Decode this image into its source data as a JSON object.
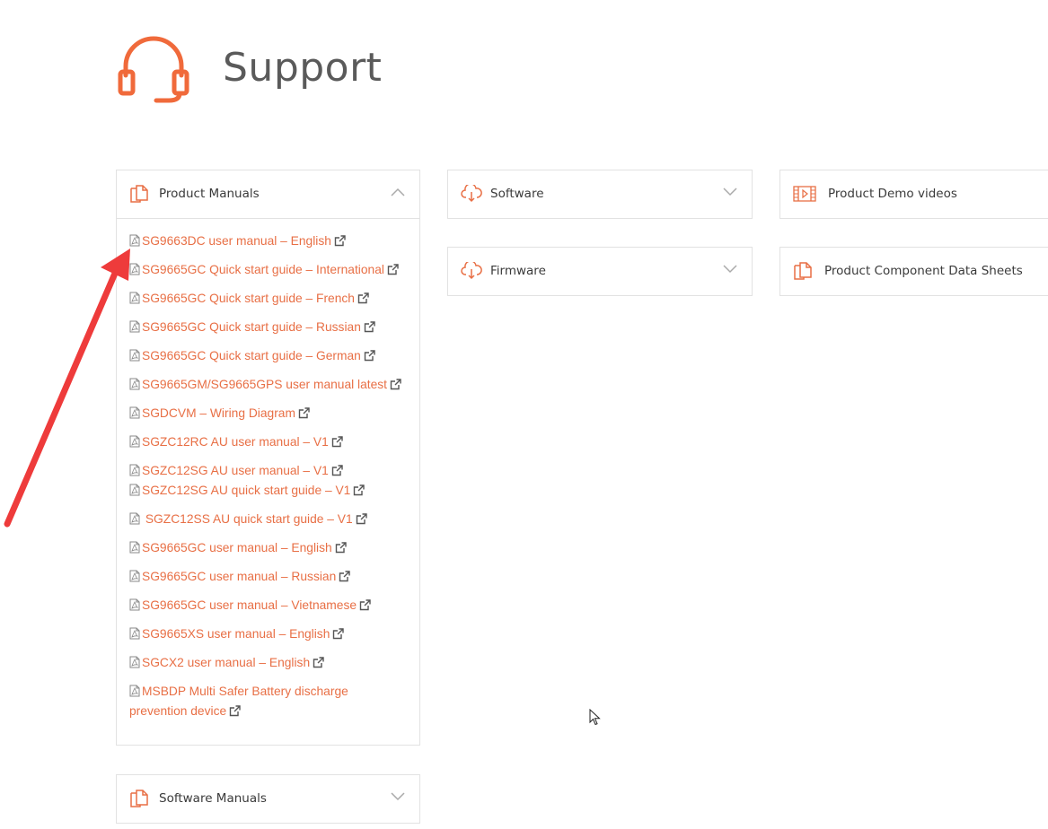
{
  "page": {
    "title": "Support"
  },
  "panels": {
    "product_manuals": {
      "label": "Product Manuals",
      "expanded": true
    },
    "software": {
      "label": "Software"
    },
    "product_demo_videos": {
      "label": "Product Demo videos"
    },
    "firmware": {
      "label": "Firmware"
    },
    "product_component_data_sheets": {
      "label": "Product Component Data Sheets"
    },
    "software_manuals": {
      "label": "Software Manuals"
    }
  },
  "manuals": [
    "SG9663DC user manual – English",
    "SG9665GC Quick start guide – International",
    "SG9665GC Quick start guide – French",
    "SG9665GC Quick start guide – Russian",
    "SG9665GC Quick start guide – German",
    "SG9665GM/SG9665GPS user manual latest",
    "SGDCVM – Wiring Diagram",
    "SGZC12RC AU user manual – V1",
    "SGZC12SG AU user manual – V1",
    "SGZC12SG AU quick start guide – V1",
    " SGZC12SS AU quick start guide – V1",
    "SG9665GC user manual – English",
    "SG9665GC user manual – Russian",
    "SG9665GC user manual – Vietnamese",
    "SG9665XS user manual – English",
    "SGCX2 user manual – English",
    "MSBDP Multi Safer Battery discharge prevention device"
  ],
  "colors": {
    "accent": "#e86f45",
    "annotation_arrow": "#ee3b3b",
    "title": "#5a5a5a",
    "border": "#e2e2e2"
  },
  "icons": {
    "header": "headset-icon",
    "docs": "documents-icon",
    "cloud": "cloud-download-icon",
    "video": "film-icon",
    "pdf": "pdf-file-icon",
    "external": "external-link-icon"
  }
}
